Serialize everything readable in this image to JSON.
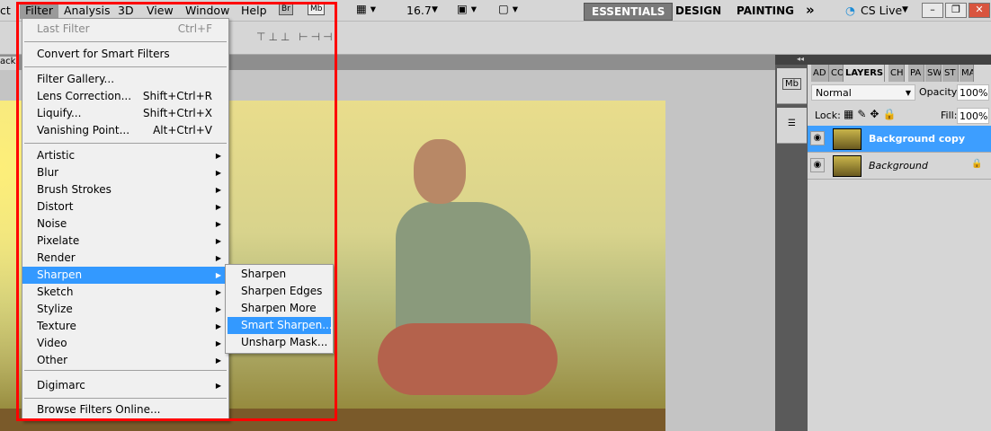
{
  "menubar": {
    "items": [
      "ct",
      "Filter",
      "Analysis",
      "3D",
      "View",
      "Window",
      "Help"
    ],
    "br": "Br",
    "mb": "Mb",
    "zoom": "16.7"
  },
  "workspaces": {
    "essentials": "ESSENTIALS",
    "design": "DESIGN",
    "painting": "PAINTING",
    "more": "»",
    "cslive": "CS Live"
  },
  "doc_tab": "ackg",
  "filter_menu": {
    "last_filter": {
      "label": "Last Filter",
      "shortcut": "Ctrl+F"
    },
    "convert": "Convert for Smart Filters",
    "gallery": "Filter Gallery...",
    "lens": {
      "label": "Lens Correction...",
      "shortcut": "Shift+Ctrl+R"
    },
    "liquify": {
      "label": "Liquify...",
      "shortcut": "Shift+Ctrl+X"
    },
    "vanishing": {
      "label": "Vanishing Point...",
      "shortcut": "Alt+Ctrl+V"
    },
    "groups": [
      "Artistic",
      "Blur",
      "Brush Strokes",
      "Distort",
      "Noise",
      "Pixelate",
      "Render",
      "Sharpen",
      "Sketch",
      "Stylize",
      "Texture",
      "Video",
      "Other"
    ],
    "digimarc": "Digimarc",
    "browse": "Browse Filters Online..."
  },
  "sharpen_submenu": [
    "Sharpen",
    "Sharpen Edges",
    "Sharpen More",
    "Smart Sharpen...",
    "Unsharp Mask..."
  ],
  "panel": {
    "tabs": [
      "AD",
      "CO",
      "LAYERS",
      "CH",
      "PA",
      "SW",
      "ST",
      "MA"
    ],
    "blend_mode": "Normal",
    "opacity_label": "Opacity:",
    "opacity": "100%",
    "lock_label": "Lock:",
    "fill_label": "Fill:",
    "fill": "100%",
    "layers": [
      {
        "name": "Background copy"
      },
      {
        "name": "Background"
      }
    ]
  },
  "dock": {
    "mb": "Mb",
    "history": "☰"
  }
}
